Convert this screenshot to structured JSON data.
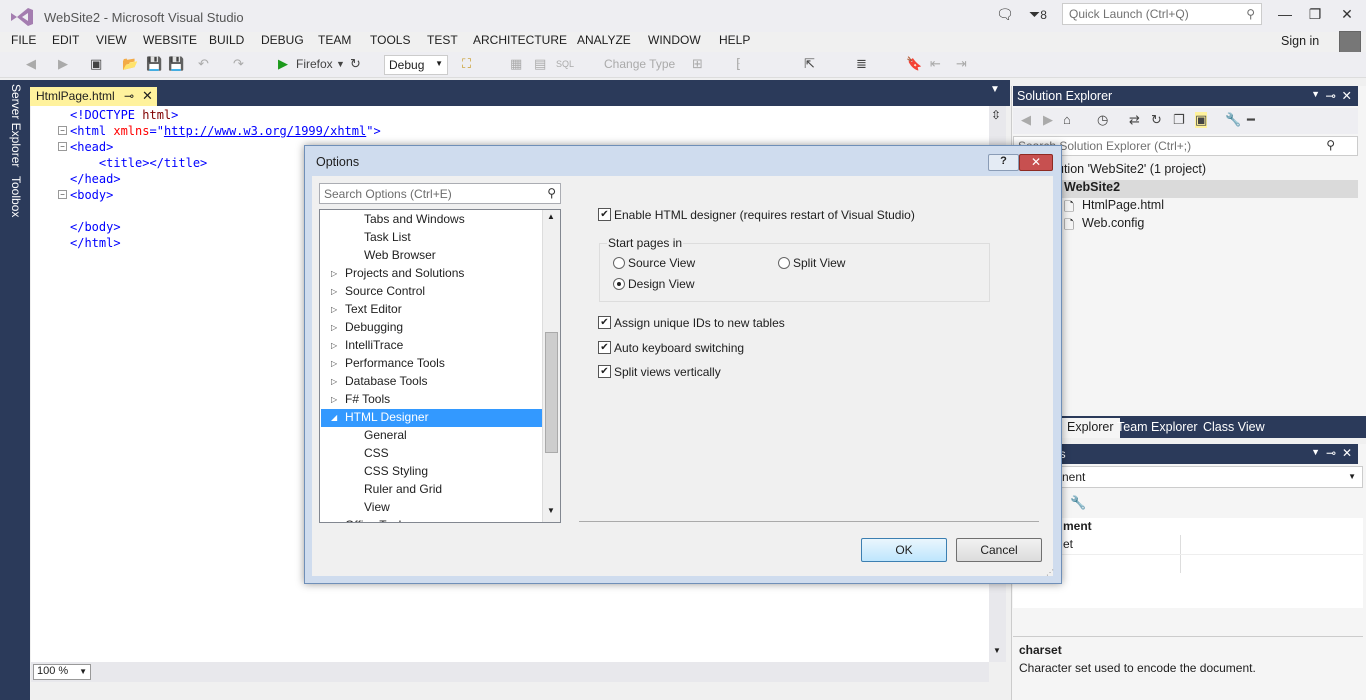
{
  "window": {
    "title": "WebSite2 - Microsoft Visual Studio",
    "notifications_count": "8"
  },
  "quick_launch": {
    "placeholder": "Quick Launch (Ctrl+Q)"
  },
  "menu": [
    "FILE",
    "EDIT",
    "VIEW",
    "WEBSITE",
    "BUILD",
    "DEBUG",
    "TEAM",
    "TOOLS",
    "TEST",
    "ARCHITECTURE",
    "ANALYZE",
    "WINDOW",
    "HELP"
  ],
  "account": {
    "sign_in": "Sign in"
  },
  "toolbar": {
    "browser": "Firefox",
    "config": "Debug",
    "change_type": "Change Type"
  },
  "sidebar": {
    "server_explorer": "Server Explorer",
    "toolbox": "Toolbox"
  },
  "editor": {
    "tab_name": "HtmlPage.html",
    "zoom": "100 %",
    "lines": [
      {
        "indent": "",
        "open": "<!DOCTYPE ",
        "attr": "",
        "eq": "",
        "val": "html",
        "close": ">"
      },
      {
        "indent": "",
        "open": "<html ",
        "attr": "xmlns",
        "eq": "=\"",
        "val": "http://www.w3.org/1999/xhtml",
        "close": "\">"
      },
      {
        "indent": "",
        "open": "<head>",
        "attr": "",
        "eq": "",
        "val": "",
        "close": ""
      },
      {
        "indent": "    ",
        "open": "<title></title>",
        "attr": "",
        "eq": "",
        "val": "",
        "close": ""
      },
      {
        "indent": "",
        "open": "</head>",
        "attr": "",
        "eq": "",
        "val": "",
        "close": ""
      },
      {
        "indent": "",
        "open": "<body>",
        "attr": "",
        "eq": "",
        "val": "",
        "close": ""
      },
      {
        "indent": "",
        "open": "",
        "attr": "",
        "eq": "",
        "val": "",
        "close": ""
      },
      {
        "indent": "",
        "open": "</body>",
        "attr": "",
        "eq": "",
        "val": "",
        "close": ""
      },
      {
        "indent": "",
        "open": "</html>",
        "attr": "",
        "eq": "",
        "val": "",
        "close": ""
      }
    ]
  },
  "solution_explorer": {
    "title": "Solution Explorer",
    "search_placeholder": "Search Solution Explorer (Ctrl+;)",
    "solution": "ution 'WebSite2' (1 project)",
    "project": "WebSite2",
    "files": [
      "HtmlPage.html",
      "Web.config"
    ],
    "tabs": [
      "Explorer",
      "Team Explorer",
      "Class View"
    ]
  },
  "properties": {
    "title": "es",
    "object": "nent",
    "category": "ment",
    "row": "et",
    "desc_title": "charset",
    "desc_text": "Character set used to encode the document."
  },
  "dialog": {
    "title": "Options",
    "help_label": "?",
    "search_placeholder": "Search Options (Ctrl+E)",
    "tree_items": [
      {
        "label": "Tabs and Windows",
        "level": 2,
        "arrow": ""
      },
      {
        "label": "Task List",
        "level": 2,
        "arrow": ""
      },
      {
        "label": "Web Browser",
        "level": 2,
        "arrow": ""
      },
      {
        "label": "Projects and Solutions",
        "level": 1,
        "arrow": "▷"
      },
      {
        "label": "Source Control",
        "level": 1,
        "arrow": "▷"
      },
      {
        "label": "Text Editor",
        "level": 1,
        "arrow": "▷"
      },
      {
        "label": "Debugging",
        "level": 1,
        "arrow": "▷"
      },
      {
        "label": "IntelliTrace",
        "level": 1,
        "arrow": "▷"
      },
      {
        "label": "Performance Tools",
        "level": 1,
        "arrow": "▷"
      },
      {
        "label": "Database Tools",
        "level": 1,
        "arrow": "▷"
      },
      {
        "label": "F# Tools",
        "level": 1,
        "arrow": "▷"
      },
      {
        "label": "HTML Designer",
        "level": 1,
        "arrow": "◢"
      },
      {
        "label": "General",
        "level": 2,
        "arrow": ""
      },
      {
        "label": "CSS",
        "level": 2,
        "arrow": ""
      },
      {
        "label": "CSS Styling",
        "level": 2,
        "arrow": ""
      },
      {
        "label": "Ruler and Grid",
        "level": 2,
        "arrow": ""
      },
      {
        "label": "View",
        "level": 2,
        "arrow": ""
      },
      {
        "label": "Office Tools",
        "level": 1,
        "arrow": "▷"
      }
    ],
    "selected_item": "HTML Designer",
    "enable_designer": {
      "label": "Enable HTML designer (requires restart of Visual Studio)",
      "checked": true
    },
    "start_pages": {
      "label": "Start pages in",
      "options": [
        "Source View",
        "Split View",
        "Design View"
      ],
      "selected": "Design View"
    },
    "checkboxes": [
      {
        "label": "Assign unique IDs to new tables",
        "checked": true
      },
      {
        "label": "Auto keyboard switching",
        "checked": true
      },
      {
        "label": "Split views vertically",
        "checked": true
      }
    ],
    "ok": "OK",
    "cancel": "Cancel"
  },
  "colors": {
    "accent": "#3399ff",
    "tab_active": "#fff29d",
    "chrome_dark": "#2b3a5a"
  }
}
